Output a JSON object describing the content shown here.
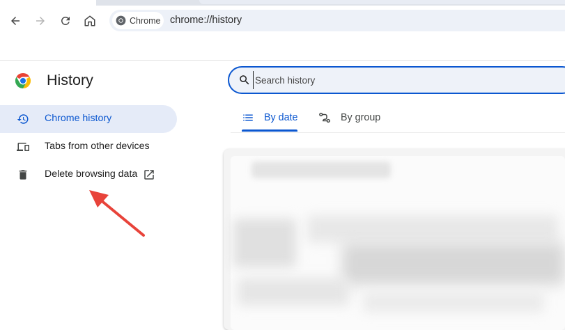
{
  "browser": {
    "back_label": "Back",
    "forward_label": "Forward",
    "reload_label": "Reload",
    "home_label": "Home",
    "site_chip": "Chrome",
    "url": "chrome://history"
  },
  "sidebar": {
    "title": "History",
    "items": [
      {
        "label": "Chrome history",
        "icon": "history-icon",
        "selected": true
      },
      {
        "label": "Tabs from other devices",
        "icon": "devices-icon",
        "selected": false
      },
      {
        "label": "Delete browsing data",
        "icon": "trash-icon",
        "selected": false,
        "external": true
      }
    ]
  },
  "search": {
    "placeholder": "Search history",
    "value": ""
  },
  "tabs": [
    {
      "label": "By date",
      "icon": "list-icon",
      "selected": true
    },
    {
      "label": "By group",
      "icon": "group-icon",
      "selected": false
    }
  ],
  "colors": {
    "accent": "#0b57d0",
    "selected_bg": "#e5ebf8",
    "annotation_arrow": "#e8433a"
  }
}
